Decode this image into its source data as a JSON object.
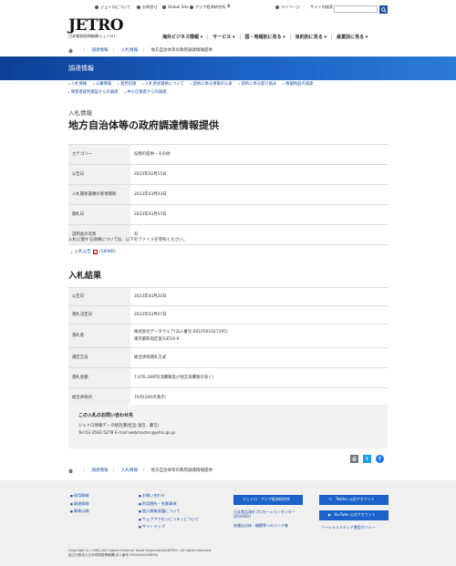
{
  "util": {
    "about": "ジェトロについて",
    "contact": "お問合せ",
    "global": "Global Site",
    "ide": "アジア経済研究所",
    "mypage": "マイページ",
    "search_placeholder": "サイト内検索"
  },
  "logo": {
    "main": "JETRO",
    "sub": "日本貿易振興機構(ジェトロ)"
  },
  "gnav": [
    "海外ビジネス情報 ▾",
    "サービス ▾",
    "国・地域別に見る ▾",
    "目的別に見る ▾",
    "産業別に見る ▾"
  ],
  "breadcrumb": {
    "level1": "調達情報",
    "level2": "入札情報",
    "current": "地方自治体等の政府調達情報提供"
  },
  "banner": {
    "title": "調達情報"
  },
  "subnav": {
    "row1": [
      "入札情報",
      "公募情報",
      "意見招請",
      "入札参加資格について",
      "契約に係る情報の公表",
      "契約に係る取り組み",
      "情報物品の調達"
    ],
    "row2": [
      "障害者就労施設からの調達",
      "中小企業者からの調達"
    ]
  },
  "page": {
    "kicker": "入札情報",
    "title": "地方自治体等の政府調達情報提供"
  },
  "info_table": [
    {
      "label": "カテゴリー",
      "value": "役務の提供・その他"
    },
    {
      "label": "公告日",
      "value": "2023年02月15日"
    },
    {
      "label": "入札関係書類の受領期限",
      "value": "2023年03月03日"
    },
    {
      "label": "開札日",
      "value": "2023年03月07日"
    },
    {
      "label": "説明会の有無",
      "value": "有"
    }
  ],
  "note": "入札に関する詳細については、以下のファイルを参照ください。",
  "attachment": {
    "label": "入札公告",
    "size": "(180KB)",
    "icon": "pdf-icon"
  },
  "results_title": "入札結果",
  "results": {
    "date_label": "公告日",
    "date": "2023年03月20日",
    "decision_label": "落札決定日",
    "decision": "2023年03月07日",
    "winner_label": "落札者",
    "winner_line1": "株式会社データウェア(法人番号:6010501027295)",
    "winner_line2": "東京都新宿区富久町16-8",
    "method_label": "選定方法",
    "method": "総合評価落札方式",
    "amount_label": "落札金額",
    "amount": "7,076,180円(消費税及び地方消費税を除く)",
    "score_label": "総合評価点",
    "score": "70点(200点満点)"
  },
  "contact": {
    "title": "この入札のお問い合わせ先",
    "line1": "ジェトロ情報データ統括課(担当:浅沼、藤吉)",
    "line2": "Tel:03-3582-5278 E-mail:webmaster@jetro.go.jp"
  },
  "footer": {
    "col1": [
      "採用情報",
      "調達情報",
      "情報公開"
    ],
    "col2": [
      "お問い合わせ",
      "利用規約・免責事項",
      "個人情報保護について",
      "ウェブアクセシビリティについて",
      "サイトマップ"
    ],
    "ide_btn": "ジェトロ・アジア経済研究所",
    "jfoodo": "日本食品海外プロモーションセンター(JFOODO)",
    "local": "各種自治体・機関等へのリンク集",
    "twitter": "Twitter 公式アカウント",
    "youtube": "YouTube 公式アカウント",
    "social": "ソーシャルメディア運用ポリシー",
    "copyright": "Copyright (C) 1995-2023 Japan External Trade Organization(JETRO). All rights reserved.",
    "corp": "独立行政法人日本貿易振興機構(法人番号 2010405003693)"
  },
  "colors": {
    "brand": "#1a4fa0",
    "banner_from": "#0d3f94",
    "banner_to": "#2b7ad6"
  }
}
